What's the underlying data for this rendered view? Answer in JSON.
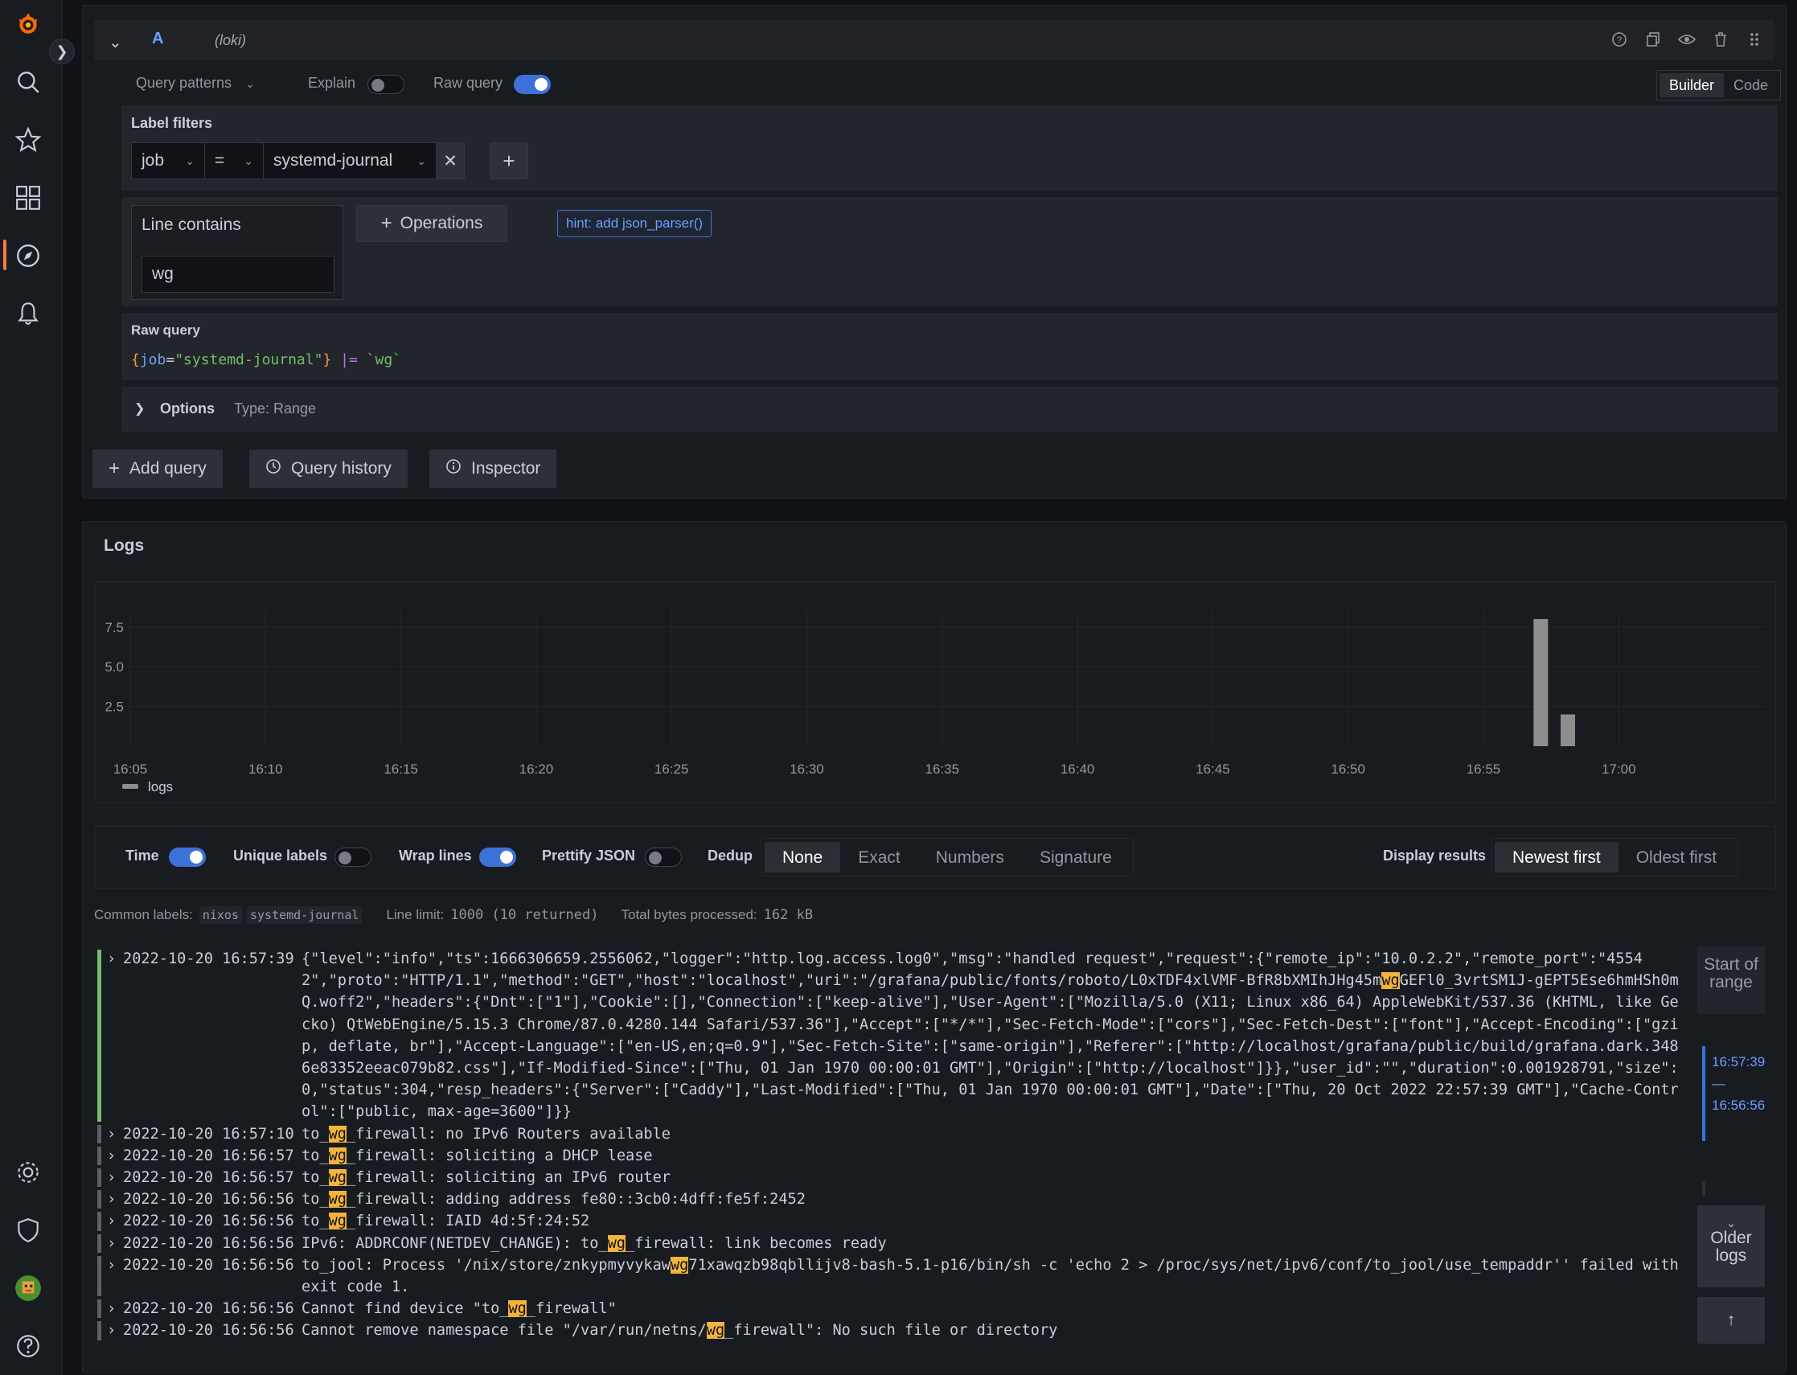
{
  "query": {
    "ref": "A",
    "datasource": "(loki)",
    "toolbar": {
      "query_patterns": "Query patterns",
      "explain": "Explain",
      "raw_query": "Raw query",
      "explain_on": false,
      "raw_query_on": true,
      "mode_builder": "Builder",
      "mode_code": "Code"
    },
    "label_filters": {
      "title": "Label filters",
      "label": "job",
      "operator": "=",
      "value": "systemd-journal"
    },
    "operations": {
      "line_contains_title": "Line contains",
      "line_contains_value": "wg",
      "operations_button": "Operations",
      "hint": "hint: add json_parser()"
    },
    "raw": {
      "title": "Raw query",
      "brace_open": "{",
      "label": "job",
      "eq": "=",
      "value": "\"systemd-journal\"",
      "brace_close": "}",
      "op": "|=",
      "filter": "`wg`"
    },
    "options": {
      "title": "Options",
      "type": "Type: Range"
    },
    "actions": {
      "add_query": "Add query",
      "query_history": "Query history",
      "inspector": "Inspector"
    }
  },
  "logs": {
    "title": "Logs",
    "legend": "logs",
    "controls": {
      "time": "Time",
      "unique_labels": "Unique labels",
      "wrap_lines": "Wrap lines",
      "prettify_json": "Prettify JSON",
      "time_on": true,
      "unique_labels_on": false,
      "wrap_lines_on": true,
      "prettify_json_on": false,
      "dedup": "Dedup",
      "dedup_options": [
        "None",
        "Exact",
        "Numbers",
        "Signature"
      ],
      "dedup_selected": "None",
      "display_results": "Display results",
      "order_options": [
        "Newest first",
        "Oldest first"
      ],
      "order_selected": "Newest first"
    },
    "meta": {
      "common_labels_label": "Common labels:",
      "common_labels": [
        "nixos",
        "systemd-journal"
      ],
      "line_limit_label": "Line limit:",
      "line_limit_value": "1000 (10 returned)",
      "bytes_label": "Total bytes processed:",
      "bytes_value": "162 kB"
    },
    "nav": {
      "start_of_range": "Start of range",
      "range_top": "16:57:39",
      "range_dash": "—",
      "range_bottom": "16:56:56",
      "older_logs": "Older logs"
    },
    "rows": [
      {
        "level": "info",
        "ts": "2022-10-20 16:57:39",
        "parts": [
          "{\"level\":\"info\",\"ts\":1666306659.2556062,\"logger\":\"http.log.access.log0\",\"msg\":\"handled request\",\"request\":{\"remote_ip\":\"10.0.2.2\",\"remote_port\":\"45542\",\"proto\":\"HTTP/1.1\",\"method\":\"GET\",\"host\":\"localhost\",\"uri\":\"/grafana/public/fonts/roboto/L0xTDF4xlVMF-BfR8bXMIhJHg45m",
          "wg",
          "GEFl0_3vrtSM1J-gEPT5Ese6hmHSh0mQ.woff2\",\"headers\":{\"Dnt\":[\"1\"],\"Cookie\":[],\"Connection\":[\"keep-alive\"],\"User-Agent\":[\"Mozilla/5.0 (X11; Linux x86_64) AppleWebKit/537.36 (KHTML, like Gecko) QtWebEngine/5.15.3 Chrome/87.0.4280.144 Safari/537.36\"],\"Accept\":[\"*/*\"],\"Sec-Fetch-Mode\":[\"cors\"],\"Sec-Fetch-Dest\":[\"font\"],\"Accept-Encoding\":[\"gzip, deflate, br\"],\"Accept-Language\":[\"en-US,en;q=0.9\"],\"Sec-Fetch-Site\":[\"same-origin\"],\"Referer\":[\"http://localhost/grafana/public/build/grafana.dark.3486e83352eeac079b82.css\"],\"If-Modified-Since\":[\"Thu, 01 Jan 1970 00:00:01 GMT\"],\"Origin\":[\"http://localhost\"]}},\"user_id\":\"\",\"duration\":0.001928791,\"size\":0,\"status\":304,\"resp_headers\":{\"Server\":[\"Caddy\"],\"Last-Modified\":[\"Thu, 01 Jan 1970 00:00:01 GMT\"],\"Date\":[\"Thu, 20 Oct 2022 22:57:39 GMT\"],\"Cache-Control\":[\"public, max-age=3600\"]}}"
        ]
      },
      {
        "level": "unknown",
        "ts": "2022-10-20 16:57:10",
        "parts": [
          "to_",
          "wg",
          "_firewall: no IPv6 Routers available"
        ]
      },
      {
        "level": "unknown",
        "ts": "2022-10-20 16:56:57",
        "parts": [
          "to_",
          "wg",
          "_firewall: soliciting a DHCP lease"
        ]
      },
      {
        "level": "unknown",
        "ts": "2022-10-20 16:56:57",
        "parts": [
          "to_",
          "wg",
          "_firewall: soliciting an IPv6 router"
        ]
      },
      {
        "level": "unknown",
        "ts": "2022-10-20 16:56:56",
        "parts": [
          "to_",
          "wg",
          "_firewall: adding address fe80::3cb0:4dff:fe5f:2452"
        ]
      },
      {
        "level": "unknown",
        "ts": "2022-10-20 16:56:56",
        "parts": [
          "to_",
          "wg",
          "_firewall: IAID 4d:5f:24:52"
        ]
      },
      {
        "level": "unknown",
        "ts": "2022-10-20 16:56:56",
        "parts": [
          "IPv6: ADDRCONF(NETDEV_CHANGE): to_",
          "wg",
          "_firewall: link becomes ready"
        ]
      },
      {
        "level": "unknown",
        "ts": "2022-10-20 16:56:56",
        "parts": [
          "to_jool: Process '/nix/store/znkypmyvykaw",
          "wg",
          "71xawqzb98qbllijv8-bash-5.1-p16/bin/sh -c 'echo 2 > /proc/sys/net/ipv6/conf/to_jool/use_tempaddr'' failed with exit code 1."
        ]
      },
      {
        "level": "unknown",
        "ts": "2022-10-20 16:56:56",
        "parts": [
          "Cannot find device \"to_",
          "wg",
          "_firewall\""
        ]
      },
      {
        "level": "unknown",
        "ts": "2022-10-20 16:56:56",
        "parts": [
          "Cannot remove namespace file \"/var/run/netns/",
          "wg",
          "_firewall\": No such file or directory"
        ]
      }
    ]
  },
  "colors": {
    "accent": "#3d71d9",
    "highlight": "#f2b43c",
    "info_level": "#73bf69",
    "brand": "#f46800"
  },
  "chart_data": {
    "type": "bar",
    "x": [
      "16:05",
      "16:10",
      "16:15",
      "16:20",
      "16:25",
      "16:30",
      "16:35",
      "16:40",
      "16:45",
      "16:50",
      "16:55",
      "17:00"
    ],
    "yticks": [
      "2.5",
      "5.0",
      "7.5"
    ],
    "series": [
      {
        "name": "logs",
        "points": [
          {
            "x": "16:57",
            "y": 8
          },
          {
            "x": "16:58",
            "y": 2
          }
        ]
      }
    ],
    "ylim": [
      0,
      8.5
    ],
    "grid": true,
    "legend": "bottom-left"
  }
}
